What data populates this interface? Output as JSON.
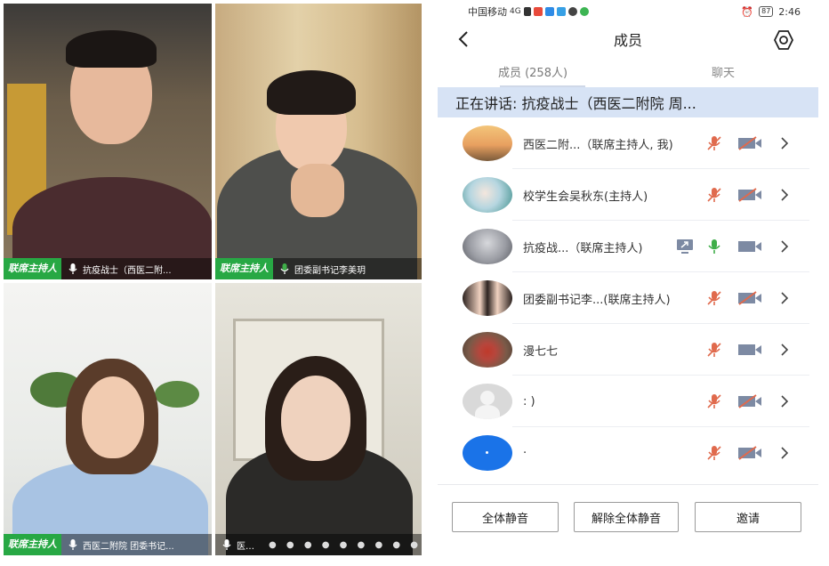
{
  "video_grid": {
    "tiles": [
      {
        "host_tag": "联席主持人",
        "caption": "抗疫战士（西医二附..."
      },
      {
        "host_tag": "联席主持人",
        "caption": "团委副书记李美玥"
      },
      {
        "host_tag": "联席主持人",
        "caption": "西医二附院 团委书记..."
      },
      {
        "host_tag": "",
        "caption": "医护 王心"
      }
    ]
  },
  "status_bar": {
    "carrier": "中国移动",
    "network": "4G",
    "battery": "87",
    "time": "2:46"
  },
  "header": {
    "title": "成员",
    "back_icon": "chevron-left-icon",
    "settings_icon": "gear-icon"
  },
  "tabs": [
    {
      "label": "成员 (258人)",
      "active": true
    },
    {
      "label": "聊天",
      "active": false
    }
  ],
  "speaking_banner": "正在讲话: 抗疫战士（西医二附院 周...",
  "members": [
    {
      "name": "西医二附...（联席主持人, 我)",
      "mic": "muted",
      "camera": "off",
      "sharing": false,
      "avatar_color": "#e8a060"
    },
    {
      "name": "校学生会吴秋东(主持人)",
      "mic": "muted",
      "camera": "off",
      "sharing": false,
      "avatar_color": "#8fc7d8"
    },
    {
      "name": "抗疫战...（联席主持人)",
      "mic": "on",
      "camera": "on",
      "sharing": true,
      "avatar_color": "#6e7077"
    },
    {
      "name": "团委副书记李...(联席主持人)",
      "mic": "muted",
      "camera": "off",
      "sharing": false,
      "avatar_color": "#3a2c2a"
    },
    {
      "name": "漫七七",
      "mic": "muted",
      "camera": "on",
      "sharing": false,
      "avatar_color": "#b6463c"
    },
    {
      "name": ": )",
      "mic": "muted",
      "camera": "off",
      "sharing": false,
      "avatar_color": "#d9d9d9"
    },
    {
      "name": "·",
      "mic": "muted",
      "camera": "off",
      "sharing": false,
      "avatar_color": "#1a73e8"
    }
  ],
  "footer": {
    "mute_all": "全体静音",
    "unmute_all": "解除全体静音",
    "invite": "邀请"
  },
  "colors": {
    "host_tag": "#27a844",
    "muted_mic": "#e06a4d",
    "active_mic": "#3fae49",
    "speaking_banner": "#d7e3f5",
    "icon_gray": "#7d8aa3"
  }
}
